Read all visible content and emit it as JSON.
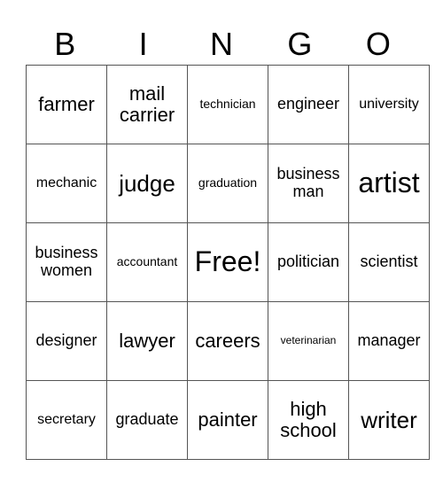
{
  "header": {
    "letters": [
      "B",
      "I",
      "N",
      "G",
      "O"
    ]
  },
  "rows": [
    [
      "farmer",
      "mail carrier",
      "technician",
      "engineer",
      "university"
    ],
    [
      "mechanic",
      "judge",
      "graduation",
      "business man",
      "artist"
    ],
    [
      "business women",
      "accountant",
      "Free!",
      "politician",
      "scientist"
    ],
    [
      "designer",
      "lawyer",
      "careers",
      "veterinarian",
      "manager"
    ],
    [
      "secretary",
      "graduate",
      "painter",
      "high school",
      "writer"
    ]
  ]
}
